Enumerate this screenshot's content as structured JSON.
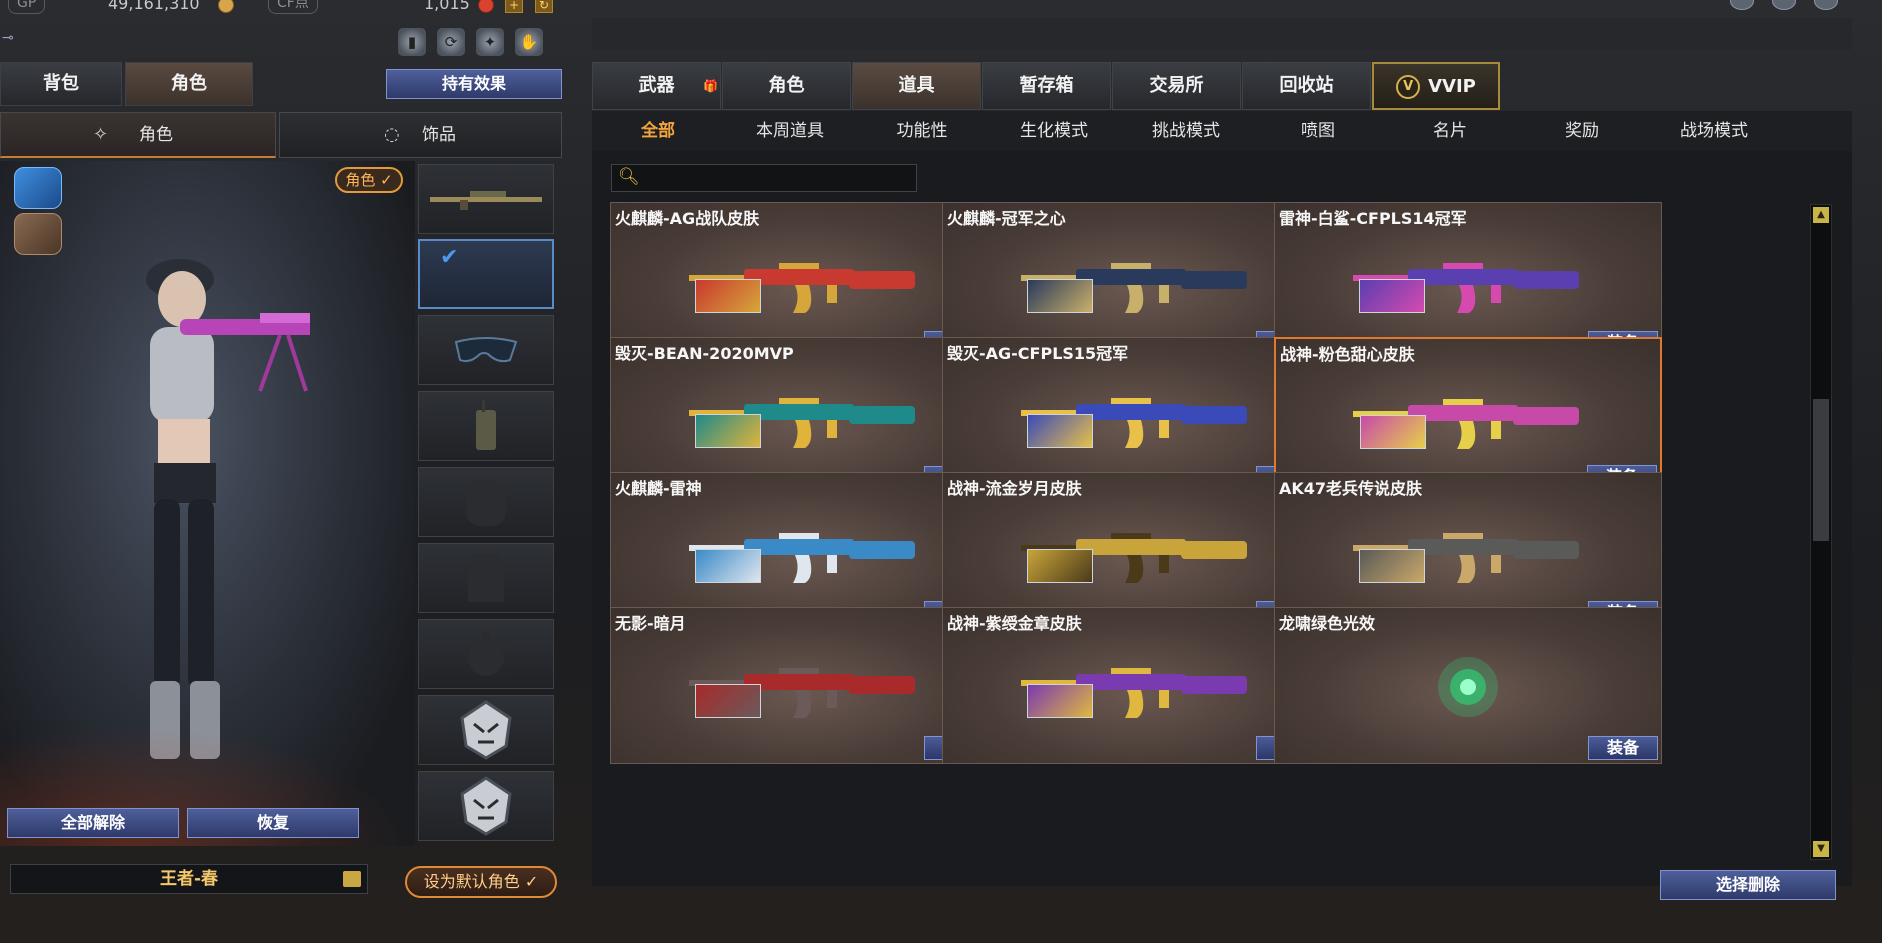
{
  "currency": {
    "gp_label": "GP",
    "gp_value": "49,161,310",
    "cf_label": "CF点",
    "cf_value": "1,015"
  },
  "left": {
    "tabs": [
      "背包",
      "角色"
    ],
    "effect_button": "持有效果",
    "sub_tabs": [
      "角色",
      "饰品"
    ],
    "role_badge": "角色 ✓",
    "unequip_all": "全部解除",
    "restore": "恢复",
    "character_name": "王者-春",
    "set_default": "设为默认角色 ✓"
  },
  "right": {
    "main_tabs": [
      "武器",
      "角色",
      "道具",
      "暂存箱",
      "交易所",
      "回收站",
      "VVIP"
    ],
    "active_main_tab": "道具",
    "sub_tabs": [
      "全部",
      "本周道具",
      "功能性",
      "生化模式",
      "挑战模式",
      "喷图",
      "名片",
      "奖励",
      "战场模式"
    ],
    "active_sub_tab": "全部",
    "search_value": "",
    "equip_label": "装备",
    "delete_button": "选择删除",
    "items": [
      {
        "title": "火麒麟-AG战队皮肤",
        "color": "#c8392f",
        "accent": "#d7a63a"
      },
      {
        "title": "火麒麟-冠军之心",
        "color": "#2a3a5c",
        "accent": "#c9b06a"
      },
      {
        "title": "雷神-白鲨-CFPLS14冠军",
        "color": "#5a3fb0",
        "accent": "#d64ab0"
      },
      {
        "title": "毁灭-BEAN-2020MVP",
        "color": "#1f8a8a",
        "accent": "#e0b43a"
      },
      {
        "title": "毁灭-AG-CFPLS15冠军",
        "color": "#3a4ab8",
        "accent": "#e8c04a"
      },
      {
        "title": "战神-粉色甜心皮肤",
        "color": "#c84aa8",
        "accent": "#e6d04a"
      },
      {
        "title": "火麒麟-雷神",
        "color": "#3a8ac8",
        "accent": "#dfe6ee"
      },
      {
        "title": "战神-流金岁月皮肤",
        "color": "#c9a43a",
        "accent": "#4a3a1a"
      },
      {
        "title": "AK47老兵传说皮肤",
        "color": "#5a5a58",
        "accent": "#c9a86a"
      },
      {
        "title": "无影-暗月",
        "color": "#a82a2a",
        "accent": "#6a5a5a"
      },
      {
        "title": "战神-紫绶金章皮肤",
        "color": "#7a3ab0",
        "accent": "#e0b840"
      },
      {
        "title": "龙啸绿色光效",
        "color": "#2ad87a",
        "accent": "#9affc8"
      }
    ],
    "selected_item": "战神-粉色甜心皮肤"
  }
}
